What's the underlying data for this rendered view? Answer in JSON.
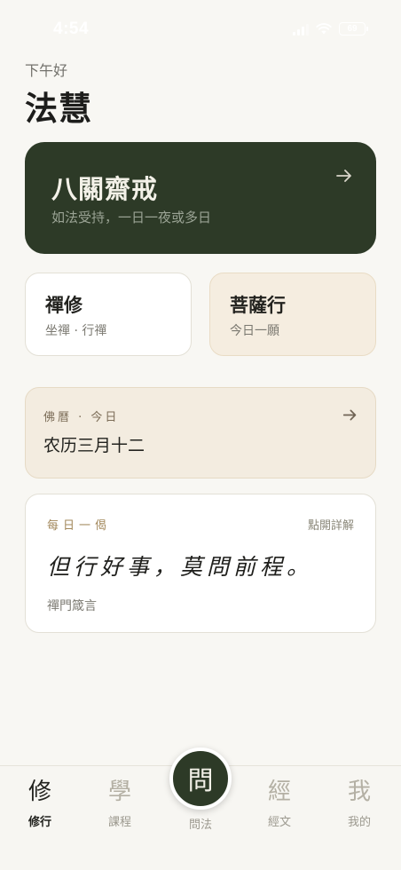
{
  "status": {
    "time": "4:54",
    "battery": "69"
  },
  "header": {
    "greeting": "下午好",
    "title": "法慧"
  },
  "hero": {
    "title": "八關齋戒",
    "subtitle": "如法受持，一日一夜或多日"
  },
  "cards": {
    "zen": {
      "title": "禪修",
      "subtitle": "坐禪 · 行禪"
    },
    "bodhi": {
      "title": "菩薩行",
      "subtitle": "今日一願"
    }
  },
  "calendar": {
    "label": "佛曆 · 今日",
    "date": "农历三月十二"
  },
  "verse": {
    "label": "每日一偈",
    "action": "點開詳解",
    "text": "但行好事，莫問前程。",
    "source": "禪門箴言"
  },
  "tabs": {
    "practice": {
      "glyph": "修",
      "label": "修行"
    },
    "study": {
      "glyph": "學",
      "label": "課程"
    },
    "ask": {
      "glyph": "問",
      "label": "問法"
    },
    "sutra": {
      "glyph": "經",
      "label": "經文"
    },
    "me": {
      "glyph": "我",
      "label": "我的"
    }
  },
  "colors": {
    "accent": "#2d3a27",
    "background": "#f8f7f3",
    "warm_card": "#f3ece0"
  },
  "icons": {
    "hero_action": "arrow-right-icon",
    "calendar_action": "arrow-right-icon"
  }
}
